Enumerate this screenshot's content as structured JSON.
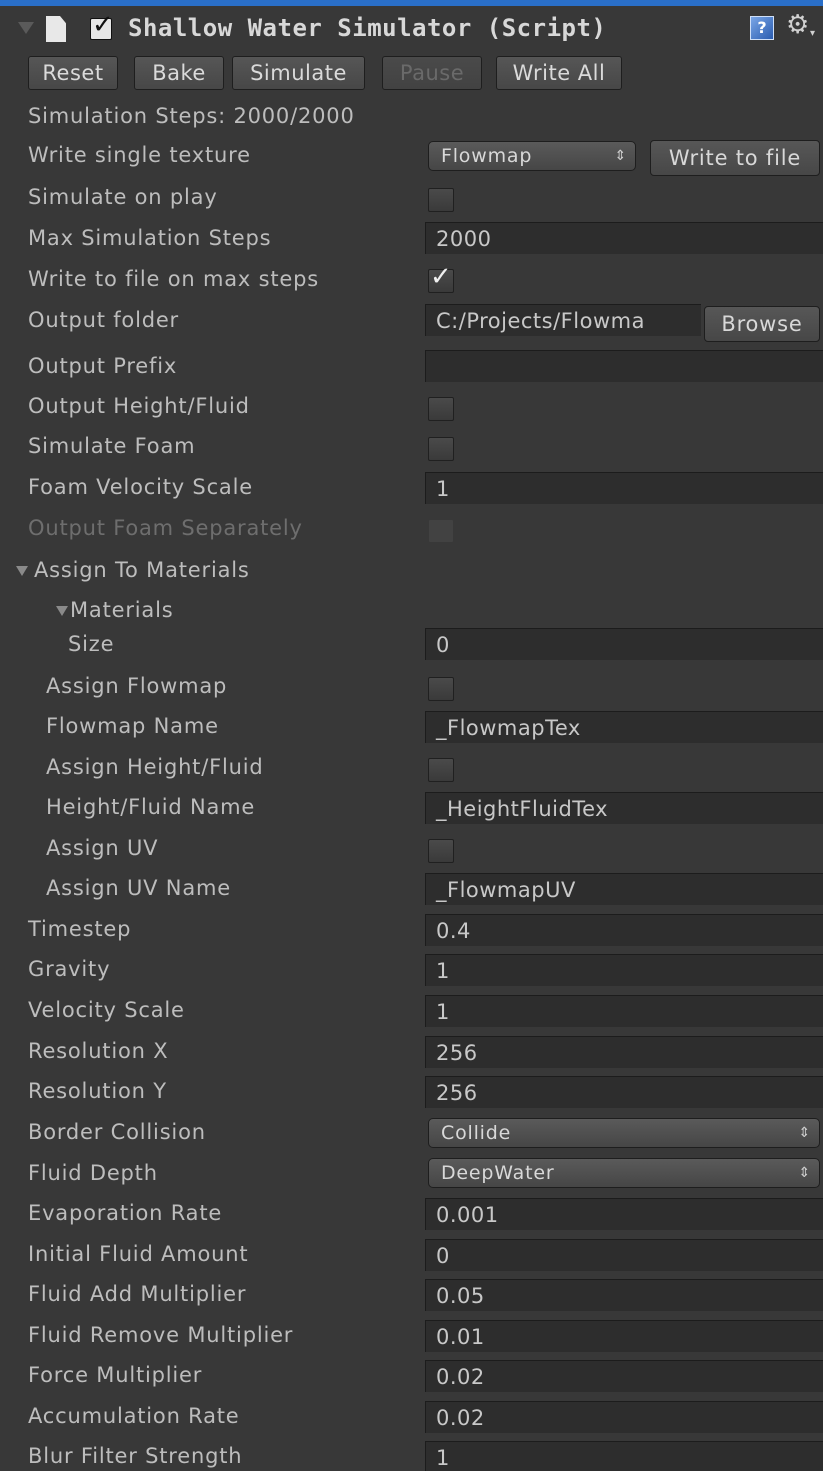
{
  "header": {
    "title": "Shallow Water Simulator (Script)",
    "enabled": true,
    "icons": [
      "foldout-arrow-icon",
      "script-document-icon",
      "enable-checkbox",
      "help-icon",
      "gear-icon"
    ]
  },
  "toolbar": {
    "reset": "Reset",
    "bake": "Bake",
    "simulate": "Simulate",
    "pause": "Pause",
    "write_all": "Write All"
  },
  "status": {
    "simulation_steps": "Simulation Steps: 2000/2000"
  },
  "write_single_texture": {
    "label": "Write single texture",
    "selected": "Flowmap",
    "button": "Write to file"
  },
  "fields": {
    "simulate_on_play": {
      "label": "Simulate on play",
      "checked": false
    },
    "max_simulation_steps": {
      "label": "Max Simulation Steps",
      "value": "2000"
    },
    "write_to_file_on_max_steps": {
      "label": "Write to file on max steps",
      "checked": true
    },
    "output_folder": {
      "label": "Output folder",
      "value": "C:/Projects/Flowma",
      "button": "Browse"
    },
    "output_prefix": {
      "label": "Output Prefix",
      "value": ""
    },
    "output_height_fluid": {
      "label": "Output Height/Fluid",
      "checked": false
    },
    "simulate_foam": {
      "label": "Simulate Foam",
      "checked": false
    },
    "foam_velocity_scale": {
      "label": "Foam Velocity Scale",
      "value": "1"
    },
    "output_foam_separately": {
      "label": "Output Foam Separately",
      "checked": false,
      "disabled": true
    }
  },
  "assign_to_materials": {
    "label": "Assign To Materials",
    "materials": {
      "label": "Materials",
      "size_label": "Size",
      "size": "0"
    },
    "assign_flowmap": {
      "label": "Assign Flowmap",
      "checked": false
    },
    "flowmap_name": {
      "label": "Flowmap Name",
      "value": "_FlowmapTex"
    },
    "assign_height_fluid": {
      "label": "Assign Height/Fluid",
      "checked": false
    },
    "height_fluid_name": {
      "label": "Height/Fluid Name",
      "value": "_HeightFluidTex"
    },
    "assign_uv": {
      "label": "Assign UV",
      "checked": false
    },
    "assign_uv_name": {
      "label": "Assign UV Name",
      "value": "_FlowmapUV"
    }
  },
  "params": {
    "timestep": {
      "label": "Timestep",
      "value": "0.4"
    },
    "gravity": {
      "label": "Gravity",
      "value": "1"
    },
    "velocity_scale": {
      "label": "Velocity Scale",
      "value": "1"
    },
    "resolution_x": {
      "label": "Resolution X",
      "value": "256"
    },
    "resolution_y": {
      "label": "Resolution Y",
      "value": "256"
    },
    "border_collision": {
      "label": "Border Collision",
      "selected": "Collide"
    },
    "fluid_depth": {
      "label": "Fluid Depth",
      "selected": "DeepWater"
    },
    "evaporation_rate": {
      "label": "Evaporation Rate",
      "value": "0.001"
    },
    "initial_fluid_amount": {
      "label": "Initial Fluid Amount",
      "value": "0"
    },
    "fluid_add_multiplier": {
      "label": "Fluid Add Multiplier",
      "value": "0.05"
    },
    "fluid_remove_multiplier": {
      "label": "Fluid Remove Multiplier",
      "value": "0.01"
    },
    "force_multiplier": {
      "label": "Force Multiplier",
      "value": "0.02"
    },
    "accumulation_rate": {
      "label": "Accumulation Rate",
      "value": "0.02"
    },
    "blur_filter_strength": {
      "label": "Blur Filter Strength",
      "value": "1"
    }
  },
  "glyphs": {
    "check": "✓",
    "gear": "⚙",
    "caret": "▾",
    "help": "?",
    "updown": "⇕"
  },
  "colors": {
    "background": "#383838",
    "field": "#2d2d2d",
    "title_strip": "#2a6fc9",
    "text": "#bdbdbd",
    "disabled_text": "#6e6e6e"
  }
}
